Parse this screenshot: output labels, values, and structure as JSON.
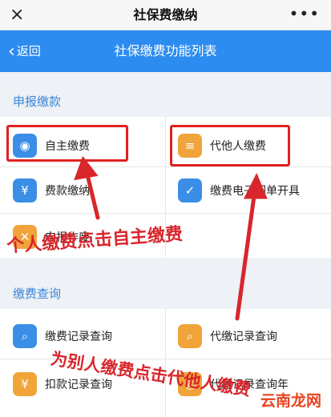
{
  "topbar": {
    "close_icon": "×",
    "title": "社保费缴纳",
    "more_icon": "•••"
  },
  "navbar": {
    "back_label": "返回",
    "title": "社保缴费功能列表"
  },
  "sections": {
    "declare": {
      "title": "申报缴款",
      "items": [
        {
          "label": "自主缴费",
          "icon": "wallet-icon",
          "color": "#3a8ee6"
        },
        {
          "label": "代他人缴费",
          "icon": "receipt-hand-icon",
          "color": "#f0a43a"
        },
        {
          "label": "费款缴纳",
          "icon": "payment-icon",
          "color": "#3a8ee6"
        },
        {
          "label": "缴费电子回单开具",
          "icon": "check-badge-icon",
          "color": "#3a8ee6"
        },
        {
          "label": "申报作废",
          "icon": "cancel-icon",
          "color": "#f0a43a"
        }
      ]
    },
    "query": {
      "title": "缴费查询",
      "items": [
        {
          "label": "缴费记录查询",
          "icon": "doc-search-icon",
          "color": "#3a8ee6"
        },
        {
          "label": "代缴记录查询",
          "icon": "search-icon",
          "color": "#f0a43a"
        },
        {
          "label": "扣款记录查询",
          "icon": "yen-icon",
          "color": "#f0a43a"
        },
        {
          "label": "代缴记录查询年",
          "icon": "record-icon",
          "color": "#f0a43a"
        }
      ]
    }
  },
  "annotations": {
    "self_pay": "个人缴费点击自主缴费",
    "others_pay": "为别人缴费点击代他人缴费"
  },
  "watermark": "云南龙网"
}
